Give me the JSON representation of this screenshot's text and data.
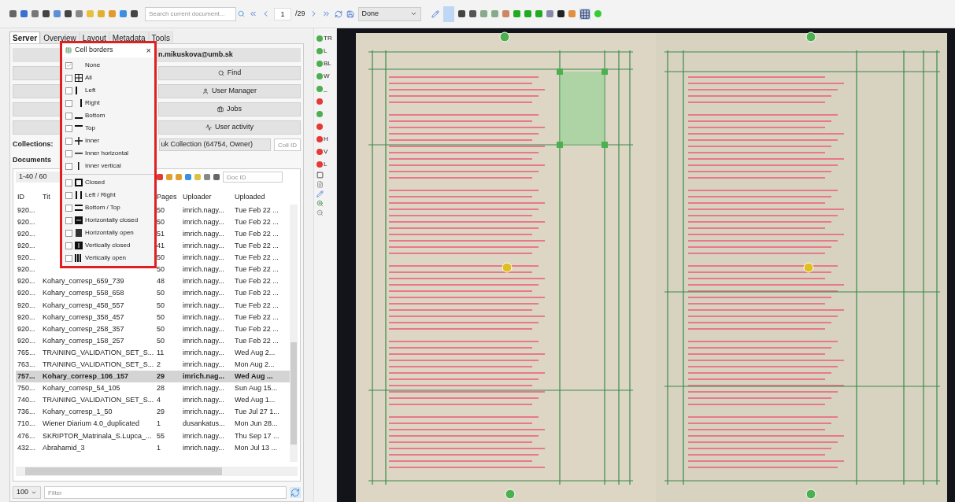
{
  "toolbar": {
    "search": {
      "placeholder": "Search current document..."
    },
    "page": "1",
    "page_count": "/29",
    "status": "Done"
  },
  "tabs": [
    {
      "label": "Server",
      "selected": true
    },
    {
      "label": "Overview",
      "selected": false
    },
    {
      "label": "Layout",
      "selected": false
    },
    {
      "label": "Metadata",
      "selected": false
    },
    {
      "label": "Tools",
      "selected": false
    }
  ],
  "server": {
    "user": "n.mikuskova@umb.sk",
    "buttons": [
      "Find",
      "User Manager",
      "Jobs",
      "User activity"
    ],
    "collections_label": "Collections:",
    "collection": "uk Collection (64754, Owner)",
    "coll_id": {
      "placeholder": "Coll ID"
    },
    "documents_label": "Documents",
    "range": "1-40 / 60",
    "doc_id": {
      "placeholder": "Doc ID"
    }
  },
  "table": {
    "columns": [
      "ID",
      "Tit",
      "Pages",
      "Uploader",
      "Uploaded"
    ],
    "rows": [
      {
        "id": "920...",
        "pages": "50",
        "uploader": "imrich.nagy...",
        "uploaded": "Tue Feb 22 ...",
        "selected": false
      },
      {
        "id": "920...",
        "pages": "50",
        "uploader": "imrich.nagy...",
        "uploaded": "Tue Feb 22 ...",
        "selected": false
      },
      {
        "id": "920...",
        "pages": "51",
        "uploader": "imrich.nagy...",
        "uploaded": "Tue Feb 22 ...",
        "selected": false
      },
      {
        "id": "920...",
        "pages": "41",
        "uploader": "imrich.nagy...",
        "uploaded": "Tue Feb 22 ...",
        "selected": false
      },
      {
        "id": "920...",
        "pages": "50",
        "uploader": "imrich.nagy...",
        "uploaded": "Tue Feb 22 ...",
        "selected": false
      },
      {
        "id": "920...",
        "pages": "50",
        "uploader": "imrich.nagy...",
        "uploaded": "Tue Feb 22 ...",
        "selected": false
      },
      {
        "id": "920...",
        "title": "Kohary_corresp_659_739",
        "pages": "48",
        "uploader": "imrich.nagy...",
        "uploaded": "Tue Feb 22 ...",
        "selected": false
      },
      {
        "id": "920...",
        "title": "Kohary_corresp_558_658",
        "pages": "50",
        "uploader": "imrich.nagy...",
        "uploaded": "Tue Feb 22 ...",
        "selected": false
      },
      {
        "id": "920...",
        "title": "Kohary_corresp_458_557",
        "pages": "50",
        "uploader": "imrich.nagy...",
        "uploaded": "Tue Feb 22 ...",
        "selected": false
      },
      {
        "id": "920...",
        "title": "Kohary_corresp_358_457",
        "pages": "50",
        "uploader": "imrich.nagy...",
        "uploaded": "Tue Feb 22 ...",
        "selected": false
      },
      {
        "id": "920...",
        "title": "Kohary_corresp_258_357",
        "pages": "50",
        "uploader": "imrich.nagy...",
        "uploaded": "Tue Feb 22 ...",
        "selected": false
      },
      {
        "id": "920...",
        "title": "Kohary_corresp_158_257",
        "pages": "50",
        "uploader": "imrich.nagy...",
        "uploaded": "Tue Feb 22 ...",
        "selected": false
      },
      {
        "id": "765...",
        "title": "TRAINING_VALIDATION_SET_S...",
        "pages": "11",
        "uploader": "imrich.nagy...",
        "uploaded": "Wed Aug 2...",
        "selected": false
      },
      {
        "id": "763...",
        "title": "TRAINING_VALIDATION_SET_S...",
        "pages": "2",
        "uploader": "imrich.nagy...",
        "uploaded": "Mon Aug 2...",
        "selected": false
      },
      {
        "id": "757...",
        "title": "Kohary_corresp_106_157",
        "pages": "29",
        "uploader": "imrich.nag...",
        "uploaded": "Wed Aug ...",
        "selected": true
      },
      {
        "id": "750...",
        "title": "Kohary_corresp_54_105",
        "pages": "28",
        "uploader": "imrich.nagy...",
        "uploaded": "Sun Aug 15...",
        "selected": false
      },
      {
        "id": "740...",
        "title": "TRAINING_VALIDATION_SET_S...",
        "pages": "4",
        "uploader": "imrich.nagy...",
        "uploaded": "Wed Aug 1...",
        "selected": false
      },
      {
        "id": "736...",
        "title": "Kohary_corresp_1_50",
        "pages": "29",
        "uploader": "imrich.nagy...",
        "uploaded": "Tue Jul 27 1...",
        "selected": false
      },
      {
        "id": "710...",
        "title": "Wiener Diarium 4.0_duplicated",
        "pages": "1",
        "uploader": "dusankatus...",
        "uploaded": "Mon Jun 28...",
        "selected": false
      },
      {
        "id": "476...",
        "title": "SKRIPTOR_Matrinala_S.Lupca_...",
        "pages": "55",
        "uploader": "imrich.nagy...",
        "uploaded": "Thu Sep 17 ...",
        "selected": false
      },
      {
        "id": "432...",
        "title": "Abrahamid_3",
        "pages": "1",
        "uploader": "imrich.nagy...",
        "uploaded": "Mon Jul 13 ...",
        "selected": false
      }
    ]
  },
  "footer": {
    "page_size": "100",
    "filter": {
      "placeholder": "Filter"
    }
  },
  "tools": [
    {
      "label": "TR",
      "color": "#4caf50"
    },
    {
      "label": "L",
      "color": "#4caf50"
    },
    {
      "label": "BL",
      "color": "#4caf50"
    },
    {
      "label": "W",
      "color": "#4caf50"
    },
    {
      "label": "_",
      "color": "#4caf50"
    },
    {
      "color": "#e53935"
    },
    {
      "color": "#4caf50"
    },
    {
      "color": "#e53935"
    },
    {
      "label": "H",
      "color": "#e53935"
    },
    {
      "label": "V",
      "color": "#e53935"
    },
    {
      "label": "L",
      "color": "#e53935"
    }
  ],
  "popup": {
    "title": "Cell borders",
    "close": "×",
    "groups": [
      [
        {
          "kind": "none",
          "label": "None",
          "checked": true
        },
        {
          "kind": "all",
          "label": "All",
          "checked": false
        },
        {
          "kind": "left",
          "label": "Left",
          "checked": false
        },
        {
          "kind": "right",
          "label": "Right",
          "checked": false
        },
        {
          "kind": "bottom",
          "label": "Bottom",
          "checked": false
        },
        {
          "kind": "top",
          "label": "Top",
          "checked": false
        },
        {
          "kind": "inner",
          "label": "Inner",
          "checked": false
        },
        {
          "kind": "inner-h",
          "label": "Inner horizontal",
          "checked": false
        },
        {
          "kind": "inner-v",
          "label": "Inner vertical",
          "checked": false
        }
      ],
      [
        {
          "kind": "closed",
          "label": "Closed",
          "checked": false
        },
        {
          "kind": "left-right",
          "label": "Left / Right",
          "checked": false
        },
        {
          "kind": "bottom-top",
          "label": "Bottom / Top",
          "checked": false
        },
        {
          "kind": "h-closed",
          "label": "Horizontally closed",
          "checked": false
        },
        {
          "kind": "h-open",
          "label": "Horizontally open",
          "checked": false
        },
        {
          "kind": "v-closed",
          "label": "Vertically closed",
          "checked": false
        },
        {
          "kind": "v-open",
          "label": "Vertically open",
          "checked": false
        }
      ]
    ]
  }
}
